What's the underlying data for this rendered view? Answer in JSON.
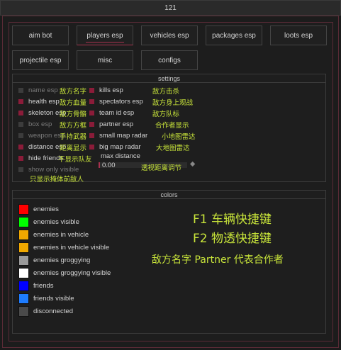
{
  "window": {
    "title": "121"
  },
  "tabs": [
    {
      "label": "aim bot"
    },
    {
      "label": "players esp",
      "active": true
    },
    {
      "label": "vehicles esp"
    },
    {
      "label": "packages esp"
    },
    {
      "label": "loots esp"
    },
    {
      "label": "projectile esp"
    },
    {
      "label": "misc"
    },
    {
      "label": "configs"
    }
  ],
  "settings": {
    "title": "settings",
    "left": [
      {
        "label": "name esp",
        "enabled": false,
        "dim": true,
        "annotation": "敌方名字"
      },
      {
        "label": "health esp",
        "enabled": true,
        "annotation": "敌方血量"
      },
      {
        "label": "skeleton esp",
        "enabled": true,
        "annotation": "敌方骨骼"
      },
      {
        "label": "box esp",
        "enabled": false,
        "dim": true,
        "annotation": "敌方方框"
      },
      {
        "label": "weapon esp",
        "enabled": false,
        "dim": true,
        "annotation": "手持武器"
      },
      {
        "label": "distance esp",
        "enabled": true,
        "annotation": "距离显示"
      },
      {
        "label": "hide friends",
        "enabled": true,
        "annotation": "不显示队友"
      },
      {
        "label": "show only visible",
        "enabled": false,
        "dim": true,
        "annotation": "只显示掩体前敌人"
      }
    ],
    "right": [
      {
        "label": "kills esp",
        "enabled": true,
        "annotation": "敌方击杀"
      },
      {
        "label": "spectators esp",
        "enabled": true,
        "annotation": "敌方身上观战"
      },
      {
        "label": "team id esp",
        "enabled": true,
        "annotation": "敌方队标"
      },
      {
        "label": "partner esp",
        "enabled": true,
        "annotation": "合作者显示"
      },
      {
        "label": "small map radar",
        "enabled": true,
        "annotation": "小地图雷达"
      },
      {
        "label": "big map radar",
        "enabled": true,
        "annotation": "大地图雷达"
      }
    ],
    "slider": {
      "label": "max distance",
      "value": "0.00",
      "annotation": "透视距离调节",
      "fill_fraction": 0.0
    }
  },
  "colors": {
    "title": "colors",
    "items": [
      {
        "label": "enemies",
        "color": "#ff0000"
      },
      {
        "label": "enemies visible",
        "color": "#00ff00"
      },
      {
        "label": "enemies in vehicle",
        "color": "#f0a800"
      },
      {
        "label": "enemies in vehicle visible",
        "color": "#f0a800"
      },
      {
        "label": "enemies groggying",
        "color": "#9a9a9a"
      },
      {
        "label": "enemies groggying visible",
        "color": "#ffffff"
      },
      {
        "label": "friends",
        "color": "#0000ff"
      },
      {
        "label": "friends visible",
        "color": "#1e7cff"
      },
      {
        "label": "disconnected",
        "color": "#4a4a4a"
      }
    ],
    "notes": {
      "f1": "F1  车辆快捷键",
      "f2": "F2  物透快捷键",
      "partner": "敌方名字 Partner 代表合作者"
    }
  },
  "colors_theme": {
    "accent": "#a8324e",
    "annotation": "#c8e43a",
    "checkbox_on": "#8b1c39"
  }
}
